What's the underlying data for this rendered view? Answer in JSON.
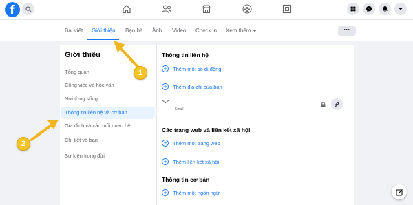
{
  "topbar": {
    "logo_letter": "f",
    "nav_icons": [
      "home-icon",
      "friends-icon",
      "marketplace-icon",
      "groups-icon",
      "gaming-icon"
    ],
    "right_icons": [
      "menu-grid-icon",
      "messenger-icon",
      "notifications-icon",
      "account-dropdown-icon"
    ]
  },
  "tabs": [
    {
      "label": "Bài viết"
    },
    {
      "label": "Giới thiệu",
      "active": true
    },
    {
      "label": "Bạn bè"
    },
    {
      "label": "Ảnh"
    },
    {
      "label": "Video"
    },
    {
      "label": "Check in"
    },
    {
      "label": "Xem thêm"
    }
  ],
  "more_button": "···",
  "about": {
    "title": "Giới thiệu",
    "items": [
      {
        "label": "Tổng quan"
      },
      {
        "label": "Công việc và học vấn"
      },
      {
        "label": "Nơi từng sống"
      },
      {
        "label": "Thông tin liên hệ và cơ bản",
        "active": true
      },
      {
        "label": "Gia đình và các mối quan hệ"
      },
      {
        "label": "Chi tiết về bạn"
      },
      {
        "label": "Sự kiện trong đời"
      }
    ]
  },
  "content": {
    "contact_title": "Thông tin liên hệ",
    "add_phone": "Thêm một số di động",
    "add_address": "Thêm địa chỉ của bạn",
    "email_caption": "Email",
    "websites_title": "Các trang web và liên kết xã hội",
    "add_website": "Thêm một trang web",
    "add_social": "Thêm liên kết xã hội",
    "basic_title": "Thông tin cơ bản",
    "add_language": "Thêm một ngôn ngữ"
  },
  "annotations": {
    "badge1": "1",
    "badge2": "2"
  },
  "colors": {
    "accent": "#1877f2",
    "annotation": "#f7c325"
  }
}
